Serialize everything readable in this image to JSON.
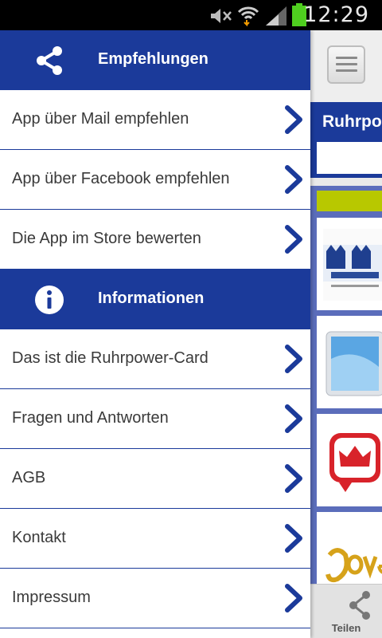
{
  "status_bar": {
    "time": "12:29"
  },
  "drawer": {
    "sections": [
      {
        "title": "Empfehlungen",
        "icon": "share-icon",
        "items": [
          {
            "label": "App über Mail empfehlen"
          },
          {
            "label": "App über Facebook empfehlen"
          },
          {
            "label": "Die App im Store bewerten"
          }
        ]
      },
      {
        "title": "Informationen",
        "icon": "info-icon",
        "items": [
          {
            "label": "Das ist die Ruhrpower-Card"
          },
          {
            "label": "Fragen und Antworten"
          },
          {
            "label": "AGB"
          },
          {
            "label": "Kontakt"
          },
          {
            "label": "Impressum"
          }
        ]
      }
    ]
  },
  "background_app": {
    "header_title": "Ruhrpo",
    "bottom_share_label": "Teilen",
    "tiles": [
      "mamma-mia-thumbnail",
      "tablet-thumbnail",
      "crown-app-thumbnail",
      "jove-thumbnail"
    ]
  },
  "colors": {
    "primary": "#1b3a9a",
    "accent_lime": "#b8c800",
    "text": "#3a3a3a"
  }
}
